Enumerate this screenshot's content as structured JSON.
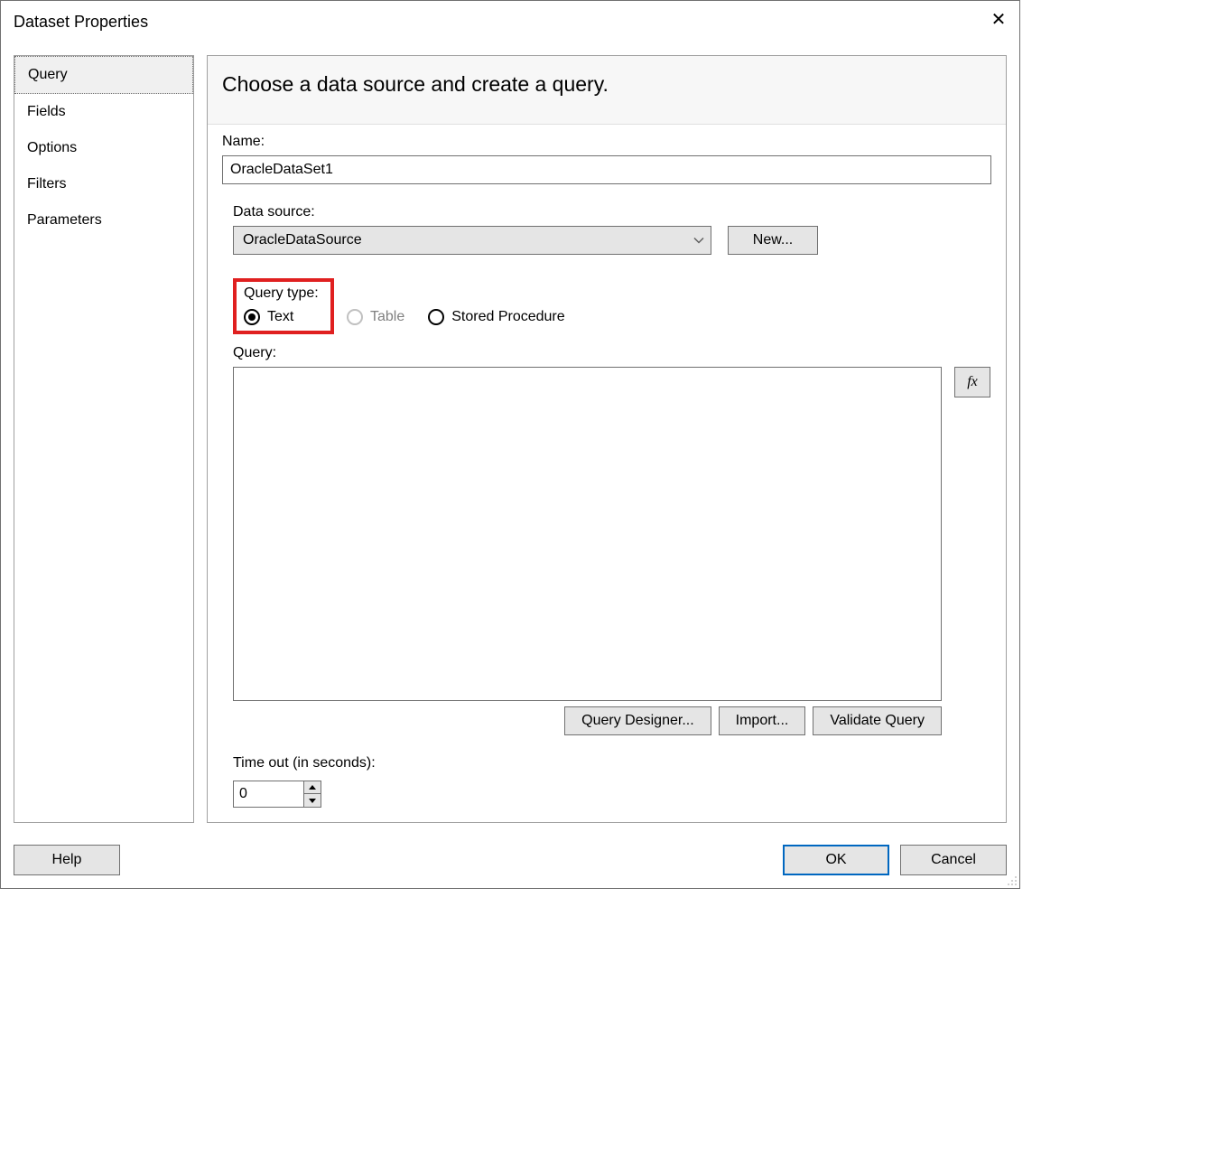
{
  "title": "Dataset Properties",
  "sidebar": {
    "items": [
      {
        "label": "Query",
        "selected": true
      },
      {
        "label": "Fields",
        "selected": false
      },
      {
        "label": "Options",
        "selected": false
      },
      {
        "label": "Filters",
        "selected": false
      },
      {
        "label": "Parameters",
        "selected": false
      }
    ]
  },
  "panel": {
    "heading": "Choose a data source and create a query.",
    "name_label": "Name:",
    "name_value": "OracleDataSet1",
    "data_source_label": "Data source:",
    "data_source_value": "OracleDataSource",
    "new_button": "New...",
    "query_type_label": "Query type:",
    "radios": {
      "text": "Text",
      "table": "Table",
      "stored_procedure": "Stored Procedure"
    },
    "query_label": "Query:",
    "query_value": "",
    "fx_label": "fx",
    "query_designer_button": "Query Designer...",
    "import_button": "Import...",
    "validate_button": "Validate Query",
    "timeout_label": "Time out (in seconds):",
    "timeout_value": "0"
  },
  "footer": {
    "help": "Help",
    "ok": "OK",
    "cancel": "Cancel"
  }
}
